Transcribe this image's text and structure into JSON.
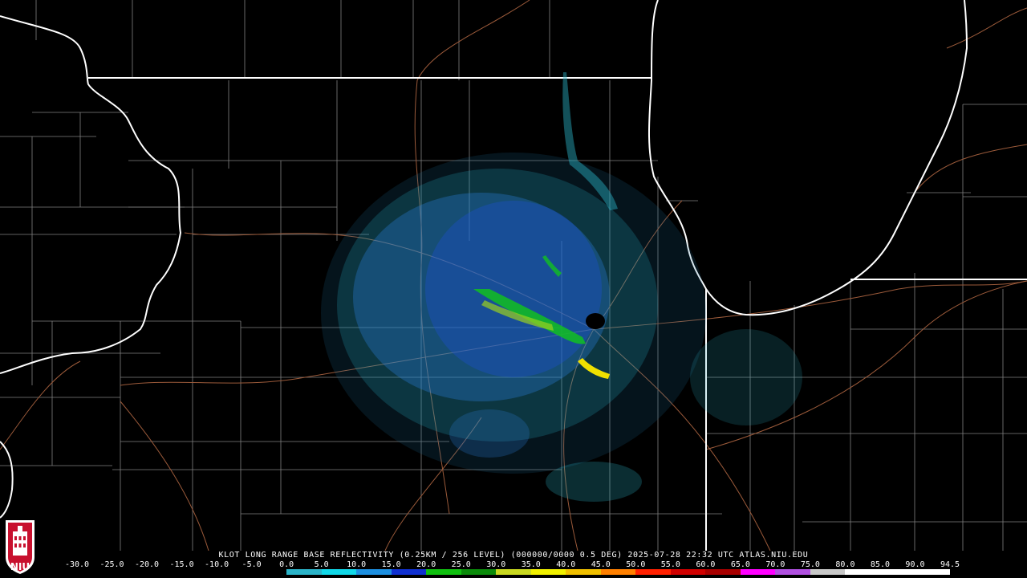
{
  "product": {
    "caption": "KLOT LONG RANGE BASE REFLECTIVITY (0.25KM / 256 LEVEL) (000000/0000 0.5 DEG) 2025-07-28 22:32 UTC  ATLAS.NIU.EDU"
  },
  "legend": {
    "labels": [
      "-30.0",
      "-25.0",
      "-20.0",
      "-15.0",
      "-10.0",
      "-5.0",
      "0.0",
      "5.0",
      "10.0",
      "15.0",
      "20.0",
      "25.0",
      "30.0",
      "35.0",
      "40.0",
      "45.0",
      "50.0",
      "55.0",
      "60.0",
      "65.0",
      "70.0",
      "75.0",
      "80.0",
      "85.0",
      "90.0",
      "94.5"
    ],
    "colors": [
      "#000000",
      "#000000",
      "#000000",
      "#000000",
      "#000000",
      "#000000",
      "#2bb3c8",
      "#12d8e8",
      "#1d8fe0",
      "#1030d0",
      "#10c010",
      "#0a8a0a",
      "#c8d820",
      "#f0f000",
      "#f0c000",
      "#ff8000",
      "#ff2000",
      "#d00000",
      "#a80000",
      "#ff00ff",
      "#b050e0",
      "#c8c8c8",
      "#ffffff",
      "#ffffff",
      "#ffffff"
    ]
  },
  "branding": {
    "logo_text": "NIU"
  }
}
